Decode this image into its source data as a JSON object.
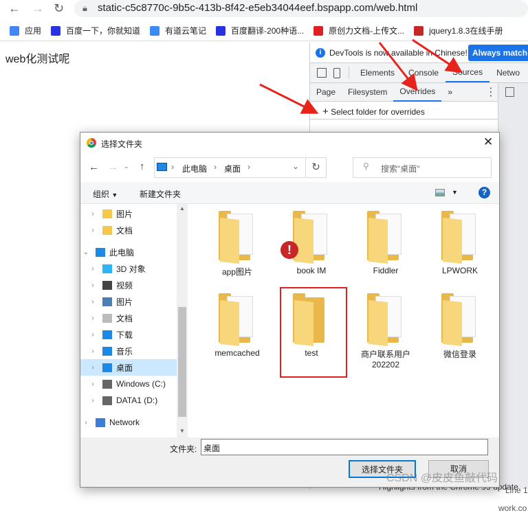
{
  "browser": {
    "url": "static-c5c8770c-9b5c-413b-8f42-e5eb34044eef.bspapp.com/web.html",
    "bookmarks": [
      {
        "label": "应用",
        "color": "#4285f4"
      },
      {
        "label": "百度一下，你就知道",
        "color": "#2932e1"
      },
      {
        "label": "有道云笔记",
        "color": "#3a8bf5"
      },
      {
        "label": "百度翻译-200种语...",
        "color": "#2932e1"
      },
      {
        "label": "原创力文档-上传文...",
        "color": "#e02020"
      },
      {
        "label": "jquery1.8.3在线手册",
        "color": "#c62828"
      }
    ]
  },
  "page": {
    "text": "web化测试呢"
  },
  "devtools": {
    "info": "DevTools is now available in Chinese!",
    "info_button": "Always match C",
    "tabs": [
      "Elements",
      "Console",
      "Sources",
      "Netwo"
    ],
    "active_tab": "Sources",
    "subtabs": [
      "Page",
      "Filesystem",
      "Overrides",
      "»"
    ],
    "active_subtab": "Overrides",
    "select_folder": "Select folder for overrides",
    "line_label": "Line 1:",
    "work_label": "work.co",
    "highlights": "Highlights from the Chrome 99 update"
  },
  "dialog": {
    "title": "选择文件夹",
    "path": [
      "此电脑",
      "桌面"
    ],
    "search_placeholder": "搜索\"桌面\"",
    "organize": "组织",
    "new_folder": "新建文件夹",
    "tree": [
      {
        "label": "图片",
        "level": 1,
        "icon": "folder"
      },
      {
        "label": "文档",
        "level": 1,
        "icon": "folder"
      },
      {
        "label": "此电脑",
        "level": 0,
        "icon": "pc",
        "expanded": true
      },
      {
        "label": "3D 对象",
        "level": 1,
        "icon": "3d"
      },
      {
        "label": "视频",
        "level": 1,
        "icon": "video"
      },
      {
        "label": "图片",
        "level": 1,
        "icon": "pictures"
      },
      {
        "label": "文档",
        "level": 1,
        "icon": "documents"
      },
      {
        "label": "下载",
        "level": 1,
        "icon": "download"
      },
      {
        "label": "音乐",
        "level": 1,
        "icon": "music"
      },
      {
        "label": "桌面",
        "level": 1,
        "icon": "desktop",
        "selected": true
      },
      {
        "label": "Windows (C:)",
        "level": 1,
        "icon": "drive"
      },
      {
        "label": "DATA1 (D:)",
        "level": 1,
        "icon": "drive"
      },
      {
        "label": "Network",
        "level": 0,
        "icon": "network"
      }
    ],
    "files": [
      {
        "name": "app图片"
      },
      {
        "name": "book IM",
        "warning": true
      },
      {
        "name": "Fiddler"
      },
      {
        "name": "LPWORK"
      },
      {
        "name": "memcached"
      },
      {
        "name": "test",
        "highlighted": true
      },
      {
        "name": "商户联系用户\n202202"
      },
      {
        "name": "微信登录"
      }
    ],
    "folder_label": "文件夹:",
    "folder_value": "桌面",
    "ok": "选择文件夹",
    "cancel": "取消"
  },
  "watermark": "CSDN @皮皮鱼敲代码"
}
